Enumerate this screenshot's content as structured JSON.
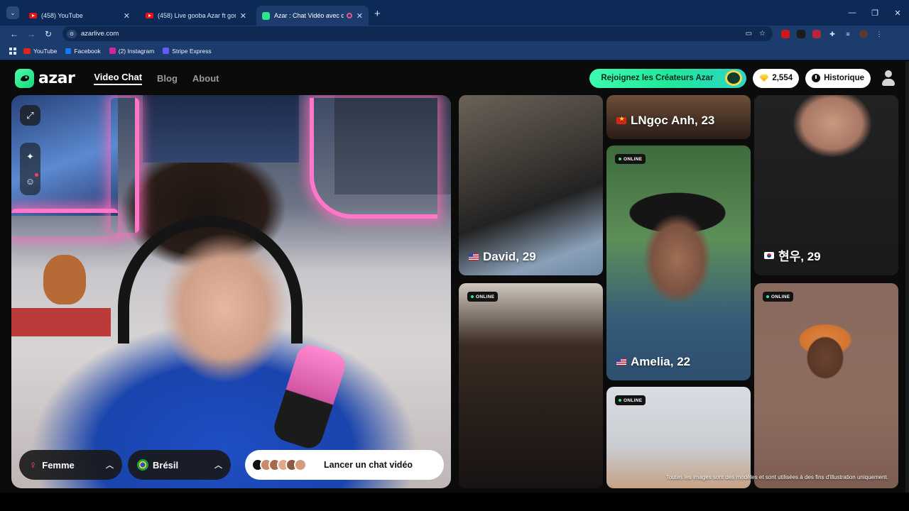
{
  "browser": {
    "tabs": [
      {
        "title": "(458) YouTube",
        "active": false
      },
      {
        "title": "(458) Live gooba Azar ft gomm",
        "active": false
      },
      {
        "title": "Azar : Chat Vidéo avec de n",
        "active": true
      }
    ],
    "url": "azarlive.com",
    "bookmarks": [
      {
        "label": "YouTube",
        "color": "#e62117"
      },
      {
        "label": "Facebook",
        "color": "#1877f2"
      },
      {
        "label": "(2) Instagram",
        "color": "#d6249f"
      },
      {
        "label": "Stripe Express",
        "color": "#635bff"
      }
    ]
  },
  "site": {
    "logo": "azar",
    "nav": [
      "Video Chat",
      "Blog",
      "About"
    ],
    "creators_button": "Rejoignez les Créateurs Azar",
    "gems": "2,554",
    "history": "Historique"
  },
  "camera": {
    "gender_filter": "Femme",
    "country_filter": "Brésil",
    "start_button": "Lancer un chat vidéo",
    "face_colors": [
      "#111111",
      "#c98a6a",
      "#a86a4e",
      "#e0a98b",
      "#8d5a3f",
      "#d49b80"
    ]
  },
  "gallery": {
    "online_label": "ONLINE",
    "cards": [
      {
        "name": "David, 29",
        "flag": "us"
      },
      {
        "name": "LNgọc Anh, 23",
        "flag": "vn"
      },
      {
        "name": "Amelia, 22",
        "flag": "us"
      },
      {
        "name": "현우, 29",
        "flag": "kr"
      }
    ],
    "disclaimer": "Toutes les images sont des modèles et sont utilisées à des fins d'illustration uniquement."
  }
}
